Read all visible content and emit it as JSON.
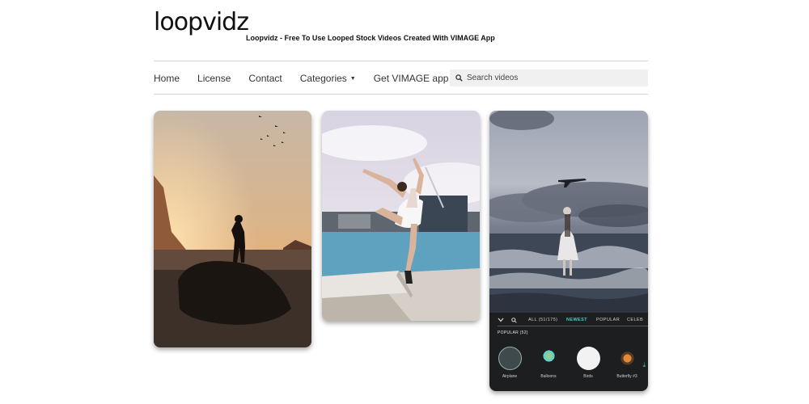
{
  "site": {
    "logo": "loopvidz",
    "tagline": "Loopvidz - Free To Use Looped Stock Videos Created With VIMAGE App"
  },
  "nav": {
    "items": [
      "Home",
      "License",
      "Contact",
      "Categories",
      "Get VIMAGE app"
    ]
  },
  "search": {
    "placeholder": "Search videos"
  },
  "app_panel": {
    "tabs": [
      "ALL (51/175)",
      "NEWEST",
      "POPULAR",
      "CELEB"
    ],
    "section": "POPULAR (52)",
    "effects": [
      "Airplane",
      "Balloons",
      "Birds",
      "Butterfly #3"
    ]
  },
  "colors": {
    "accent_tab": "#3fd0c0"
  }
}
